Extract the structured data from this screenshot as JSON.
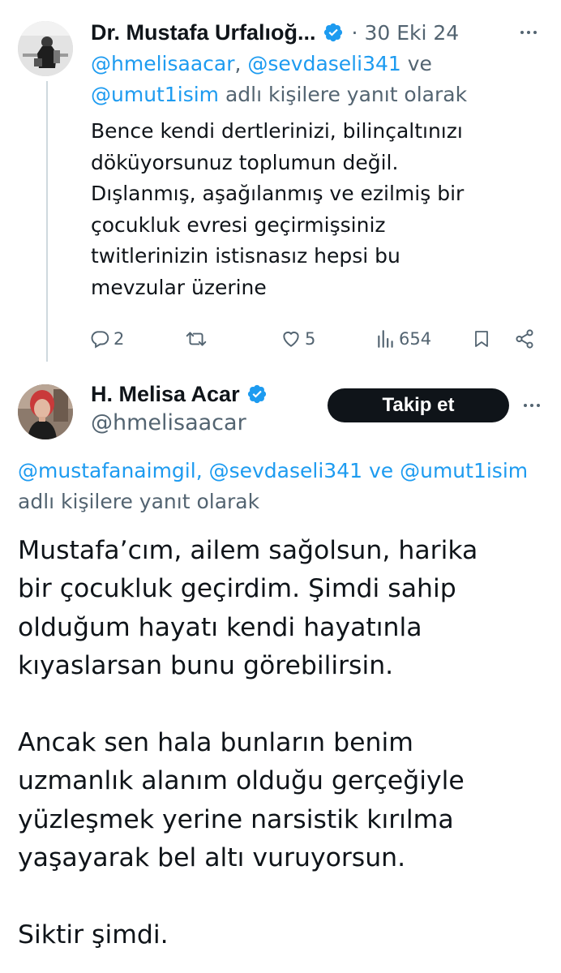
{
  "tweet1": {
    "author_name": "Dr. Mustafa Urfalıoğ...",
    "date": "· 30 Eki 24",
    "reply_to": {
      "mention1": "@hmelisaacar",
      "sep1": ", ",
      "mention2": "@sevdaseli341",
      "sep2": " ve ",
      "mention3": "@umut1isim",
      "suffix": " adlı kişilere yanıt olarak"
    },
    "text": "Bence kendi dertlerinizi, bilinçaltınızı\ndöküyorsunuz toplumun değil.\nDışlanmış, aşağılanmış ve ezilmiş bir\nçocukluk evresi geçirmişsiniz\ntwitlerinizin istisnasız hepsi bu\nmevzular üzerine",
    "replies": "2",
    "retweets": "",
    "likes": "5",
    "views": "654"
  },
  "tweet2": {
    "author_name": "H. Melisa Acar",
    "handle": "@hmelisaacar",
    "follow_label": "Takip et",
    "reply_to": {
      "mention1": "@mustafanaimgil",
      "sep1": ", ",
      "mention2": "@sevdaseli341",
      "sep2": " ve ",
      "mention3": "@umut1isim",
      "suffix": "adlı kişilere yanıt olarak"
    },
    "text": "Mustafa’cım, ailem sağolsun, harika\nbir çocukluk geçirdim. Şimdi sahip\nolduğum hayatı kendi hayatınla\nkıyaslarsan bunu görebilirsin.\n\nAncak sen hala bunların benim\nuzmanlık alanım olduğu gerçeğiyle\nyüzleşmek yerine narsistik kırılma\nyaşayarak bel altı vuruyorsun.\n\nSiktir şimdi."
  },
  "colors": {
    "accent": "#1d9bf0",
    "secondary_text": "#536471",
    "primary_text": "#0f1419",
    "thread_line": "#cfd9de"
  },
  "icons": {
    "verified": "verified-badge-icon",
    "more": "more-horizontal-icon",
    "reply": "reply-bubble-icon",
    "retweet": "retweet-icon",
    "like": "heart-icon",
    "views": "views-bar-chart-icon",
    "bookmark": "bookmark-icon",
    "share": "share-icon"
  }
}
